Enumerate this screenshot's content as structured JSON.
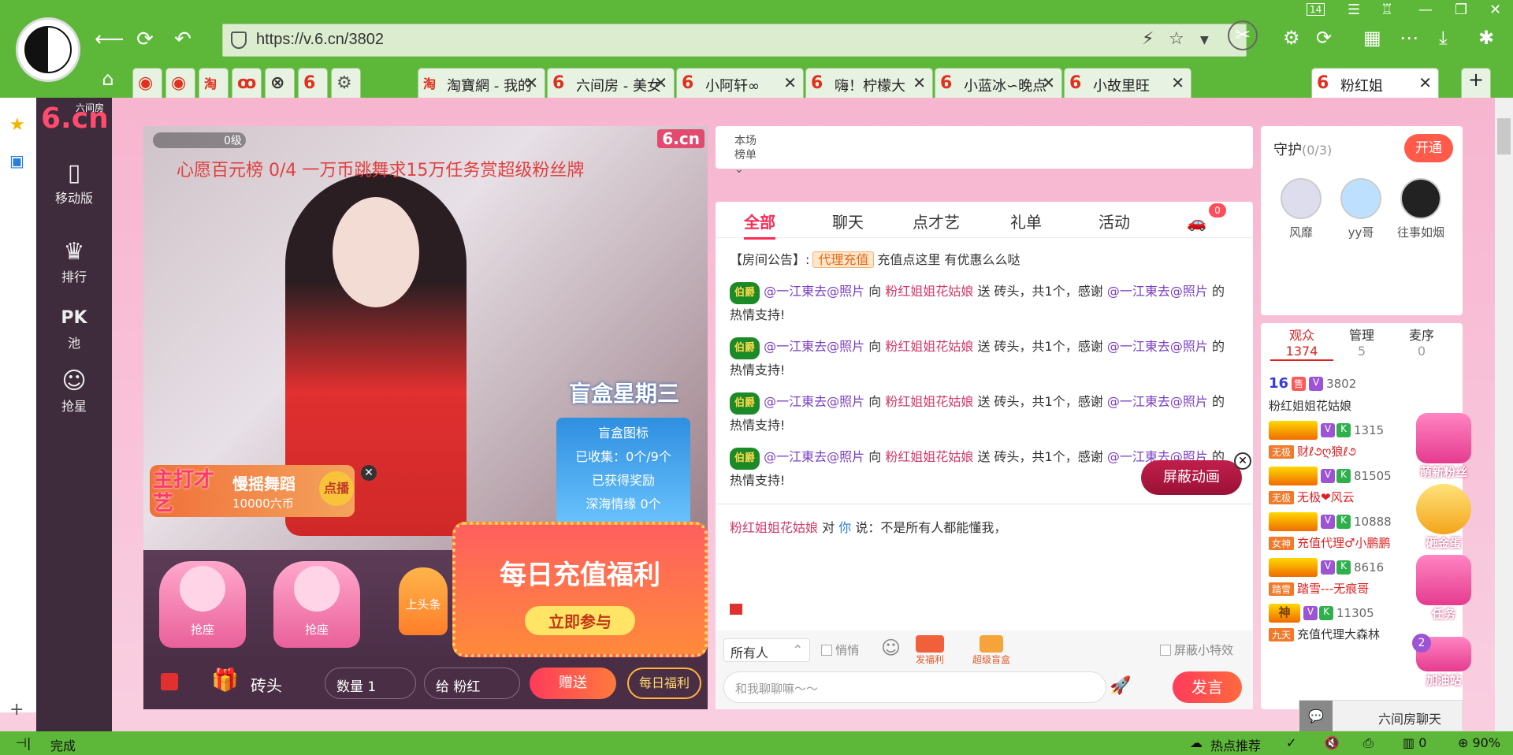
{
  "browser": {
    "url": "https://v.6.cn/3802",
    "tab_badge": "14",
    "tabs": [
      {
        "label": "淘寶網 - 我的",
        "icon": "淘"
      },
      {
        "label": "六间房 - 美女",
        "icon": "6"
      },
      {
        "label": "小阿轩∞",
        "icon": "6"
      },
      {
        "label": "嗨！柠檬大",
        "icon": "6"
      },
      {
        "label": "小蓝冰∽晚点",
        "icon": "6"
      },
      {
        "label": "小故里旺",
        "icon": "6"
      },
      {
        "label": "粉红姐",
        "icon": "6"
      }
    ],
    "new_tab": "+"
  },
  "nav": {
    "brand": "6.cn",
    "brand_sub": "六间房",
    "items": [
      {
        "label": "移动版",
        "icon": "▯"
      },
      {
        "label": "排行",
        "icon": "♛"
      },
      {
        "label": "池",
        "icon": "PK"
      },
      {
        "label": "抢星",
        "icon": "☺"
      }
    ]
  },
  "video": {
    "level": "0级",
    "slogan": "心愿百元榜 0/4 一万币跳舞求15万任务赏超级粉丝牌",
    "watermark": "6.cn",
    "blindbox_title": "盲盒星期三",
    "blindbox": {
      "icon_label": "盲盒图标",
      "collected": "已收集：0个/9个",
      "reward_label": "已获得奖励",
      "reward": "深海情缘 0个"
    },
    "promo": {
      "tag": "主打才艺",
      "name": "慢摇舞蹈",
      "price": "10000六币",
      "button": "点播"
    },
    "seats": [
      "抢座",
      "抢座"
    ],
    "toutiao": "上头条",
    "recharge": {
      "title": "每日充值福利",
      "button": "立即参与"
    }
  },
  "giftbar": {
    "gift": "砖头",
    "qty_label": "数量",
    "qty": "1",
    "to_label": "给",
    "to": "粉红",
    "send": "赠送",
    "daily": "每日福利"
  },
  "rank": {
    "label_line1": "本场",
    "label_line2": "榜单"
  },
  "chat": {
    "tabs": [
      "全部",
      "聊天",
      "点才艺",
      "礼单",
      "活动"
    ],
    "badge": "0",
    "notice": {
      "prefix": "【房间公告】:",
      "tag": "代理充值",
      "text": "充值点这里 有优惠么么哒"
    },
    "messages": [
      {
        "badge": "伯爵",
        "user": "@一江東去@照片",
        "to": "向",
        "host": "粉红姐姐花姑娘",
        "action": "送",
        "gift": "砖头，共1个，感谢",
        "thank": "@一江東去@照片",
        "end": "的热情支持!"
      },
      {
        "badge": "伯爵",
        "user": "@一江東去@照片",
        "to": "向",
        "host": "粉红姐姐花姑娘",
        "action": "送",
        "gift": "砖头，共1个，感谢",
        "thank": "@一江東去@照片",
        "end": "的热情支持!"
      },
      {
        "badge": "伯爵",
        "user": "@一江東去@照片",
        "to": "向",
        "host": "粉红姐姐花姑娘",
        "action": "送",
        "gift": "砖头，共1个，感谢",
        "thank": "@一江東去@照片",
        "end": "的热情支持!"
      },
      {
        "badge": "伯爵",
        "user": "@一江東去@照片",
        "to": "向",
        "host": "粉红姐姐花姑娘",
        "action": "送",
        "gift": "砖头，共1个，感谢",
        "thank": "@一江東去@照片",
        "end": "的热情支持!"
      }
    ],
    "private": {
      "user": "粉红姐姐花姑娘",
      "mid": "对",
      "you": "你",
      "text": "说：不是所有人都能懂我，"
    },
    "hide_anim": "屏蔽动画",
    "target": "所有人",
    "whisper": "悄悄",
    "fuli": "发福利",
    "blindbox": "超级盲盒",
    "hide_effects": "屏蔽小特效",
    "placeholder": "和我聊聊嘛～～",
    "send": "发言"
  },
  "guard": {
    "title": "守护",
    "count": "(0/3)",
    "open": "开通",
    "members": [
      "风靡",
      "yy哥",
      "往事如烟"
    ]
  },
  "audience": {
    "tabs": [
      {
        "label": "观众",
        "count": "1374"
      },
      {
        "label": "管理",
        "count": "5"
      },
      {
        "label": "麦序",
        "count": "0"
      }
    ],
    "rows": [
      {
        "level": "16",
        "num": "3802",
        "title": "",
        "name": "粉红姐姐花姑娘"
      },
      {
        "level": "",
        "num": "1315",
        "title": "无极",
        "name": "财ℓ૭ღ狼ℓ૭"
      },
      {
        "level": "",
        "num": "81505",
        "title": "无极",
        "name": "无极❤风云"
      },
      {
        "level": "",
        "num": "10888",
        "title": "女神",
        "name": "充值代理♂小鹏鹏"
      },
      {
        "level": "",
        "num": "8616",
        "title": "踏雪",
        "name": "踏雪---无痕哥"
      },
      {
        "level": "神",
        "num": "11305",
        "title": "九天",
        "name": "充值代理大森林"
      }
    ]
  },
  "floats": [
    "萌新粉丝",
    "砸金蛋",
    "任务",
    "加油站"
  ],
  "float_badge": "2",
  "chat_float": "六间房聊天",
  "status": {
    "left": "完成",
    "hot": "热点推荐",
    "dl": "0",
    "zoom": "90%"
  }
}
